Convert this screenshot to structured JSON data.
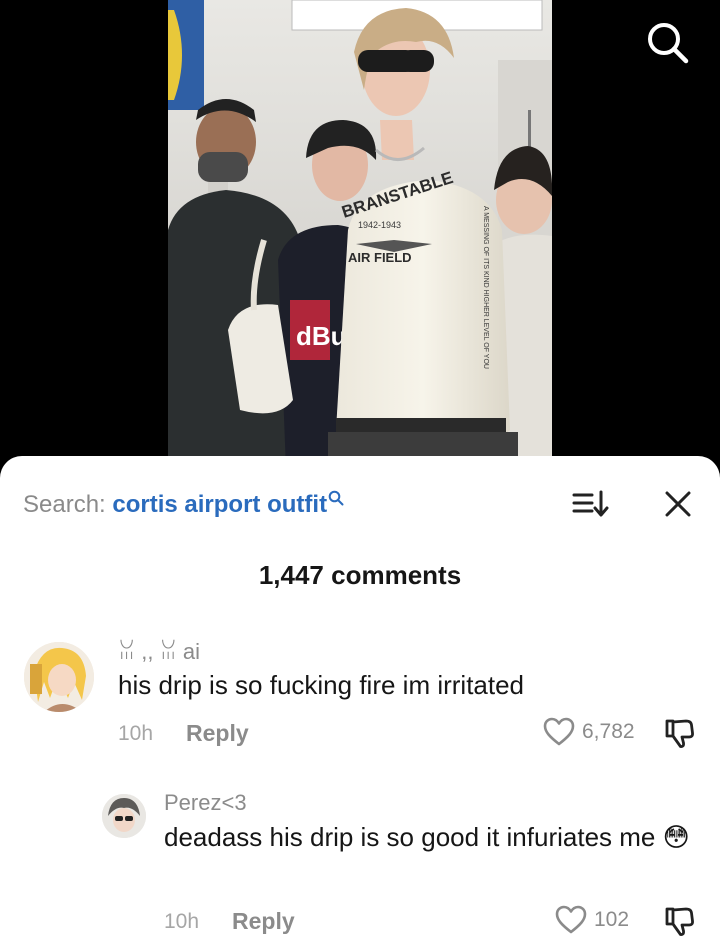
{
  "search": {
    "prefix": "Search: ",
    "term": "cortis airport outfit"
  },
  "comments_count": "1,447 comments",
  "comments": [
    {
      "username": "ꈍ ,, ꈍ ai",
      "text": "his drip is so fucking fire im irritated",
      "time": "10h",
      "reply_label": "Reply",
      "likes": "6,782"
    },
    {
      "username": "Perez<3",
      "text": "deadass his drip is so good it infuriates me 😳",
      "time": "10h",
      "reply_label": "Reply",
      "likes": "102"
    }
  ],
  "video": {
    "shirt_print_main": "BRANSTABLE",
    "shirt_print_years": "1942-1943",
    "shirt_print_sub": "AIR FIELD",
    "sleeve_print": "A MESSING OF ITS KIND HIGHER LEVEL OF YOU",
    "bag_print": "dBu"
  },
  "icons": {
    "search": "search-icon",
    "sort": "sort-icon",
    "close": "close-icon",
    "like": "heart-icon",
    "dislike": "thumbs-down-icon"
  },
  "colors": {
    "accent": "#2a6bbd",
    "muted": "#8b8b8b",
    "text": "#161616"
  }
}
